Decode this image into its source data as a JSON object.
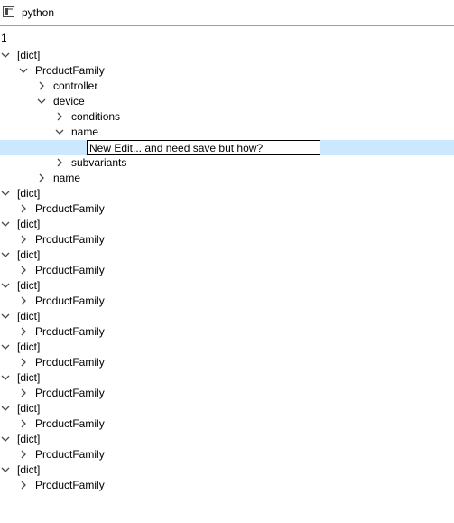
{
  "window": {
    "title": "python",
    "icon": "app-window-icon"
  },
  "header": {
    "column_label": "1"
  },
  "tree": {
    "rows": [
      {
        "label": "[dict]",
        "level": 0,
        "expanded": true
      },
      {
        "label": "ProductFamily",
        "level": 1,
        "expanded": true
      },
      {
        "label": "controller",
        "level": 2,
        "expanded": false
      },
      {
        "label": "device",
        "level": 2,
        "expanded": true
      },
      {
        "label": "conditions",
        "level": 3,
        "expanded": false
      },
      {
        "label": "name",
        "level": 3,
        "expanded": true
      },
      {
        "label": "",
        "level": 4,
        "editing": true
      },
      {
        "label": "subvariants",
        "level": 3,
        "expanded": false
      },
      {
        "label": "name",
        "level": 2,
        "expanded": false
      },
      {
        "label": "[dict]",
        "level": 0,
        "expanded": true
      },
      {
        "label": "ProductFamily",
        "level": 1,
        "expanded": false
      },
      {
        "label": "[dict]",
        "level": 0,
        "expanded": true
      },
      {
        "label": "ProductFamily",
        "level": 1,
        "expanded": false
      },
      {
        "label": "[dict]",
        "level": 0,
        "expanded": true
      },
      {
        "label": "ProductFamily",
        "level": 1,
        "expanded": false
      },
      {
        "label": "[dict]",
        "level": 0,
        "expanded": true
      },
      {
        "label": "ProductFamily",
        "level": 1,
        "expanded": false
      },
      {
        "label": "[dict]",
        "level": 0,
        "expanded": true
      },
      {
        "label": "ProductFamily",
        "level": 1,
        "expanded": false
      },
      {
        "label": "[dict]",
        "level": 0,
        "expanded": true
      },
      {
        "label": "ProductFamily",
        "level": 1,
        "expanded": false
      },
      {
        "label": "[dict]",
        "level": 0,
        "expanded": true
      },
      {
        "label": "ProductFamily",
        "level": 1,
        "expanded": false
      },
      {
        "label": "[dict]",
        "level": 0,
        "expanded": true
      },
      {
        "label": "ProductFamily",
        "level": 1,
        "expanded": false
      },
      {
        "label": "[dict]",
        "level": 0,
        "expanded": true
      },
      {
        "label": "ProductFamily",
        "level": 1,
        "expanded": false
      },
      {
        "label": "[dict]",
        "level": 0,
        "expanded": true
      },
      {
        "label": "ProductFamily",
        "level": 1,
        "expanded": false
      }
    ]
  },
  "editor": {
    "value": "New Edit... and need save but how?"
  },
  "colors": {
    "selection": "#cce8ff",
    "arrow": "#4a4a4a",
    "title_separator": "#a0a0a0"
  }
}
